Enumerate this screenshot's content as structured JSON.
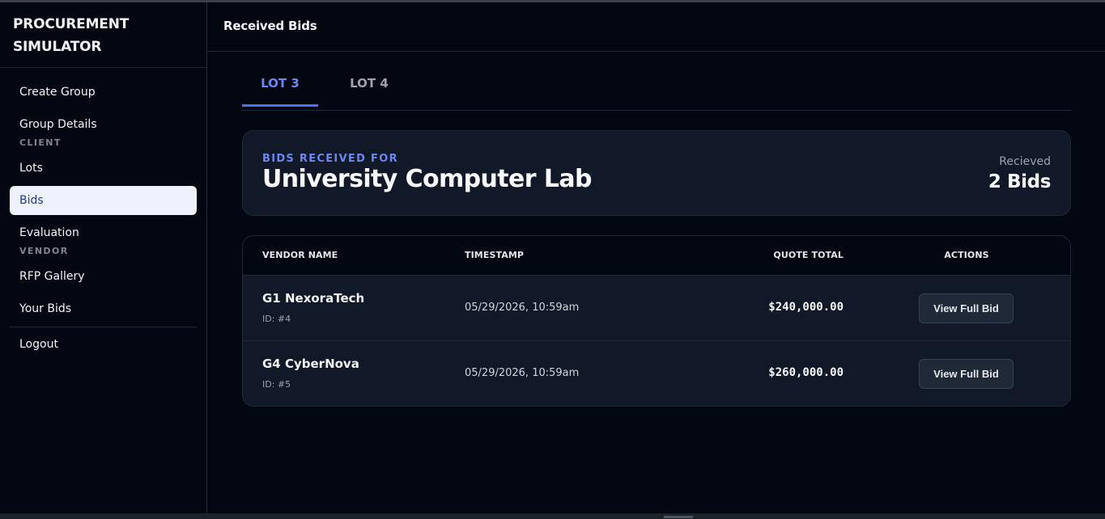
{
  "app": {
    "title_line1": "PROCUREMENT",
    "title_line2": "SIMULATOR"
  },
  "sidebar": {
    "items": [
      {
        "label": "Create Group"
      },
      {
        "label": "Group Details"
      },
      {
        "label": "Lots"
      },
      {
        "label": "Bids"
      },
      {
        "label": "Evaluation"
      },
      {
        "label": "RFP Gallery"
      },
      {
        "label": "Your Bids"
      },
      {
        "label": "Logout"
      }
    ],
    "sections": {
      "client": "CLIENT",
      "vendor": "VENDOR"
    },
    "active": "Bids"
  },
  "header": {
    "title": "Received Bids"
  },
  "tabs": [
    {
      "label": "LOT 3",
      "active": true
    },
    {
      "label": "LOT 4",
      "active": false
    }
  ],
  "summary": {
    "kicker": "BIDS RECEIVED FOR",
    "lot_name": "University Computer Lab",
    "count_label": "Recieved",
    "count_value": "2 Bids"
  },
  "table": {
    "headers": {
      "vendor": "VENDOR NAME",
      "timestamp": "TIMESTAMP",
      "quote": "QUOTE TOTAL",
      "actions": "ACTIONS"
    },
    "rows": [
      {
        "vendor": "G1 NexoraTech",
        "id": "ID: #4",
        "timestamp": "05/29/2026, 10:59am",
        "quote": "$240,000.00",
        "action": "View Full Bid"
      },
      {
        "vendor": "G4 CyberNova",
        "id": "ID: #5",
        "timestamp": "05/29/2026, 10:59am",
        "quote": "$260,000.00",
        "action": "View Full Bid"
      }
    ]
  },
  "colors": {
    "background": "#030712",
    "card": "#111827",
    "accent": "#4f6ef0",
    "active_nav_bg": "#eef2ff"
  }
}
